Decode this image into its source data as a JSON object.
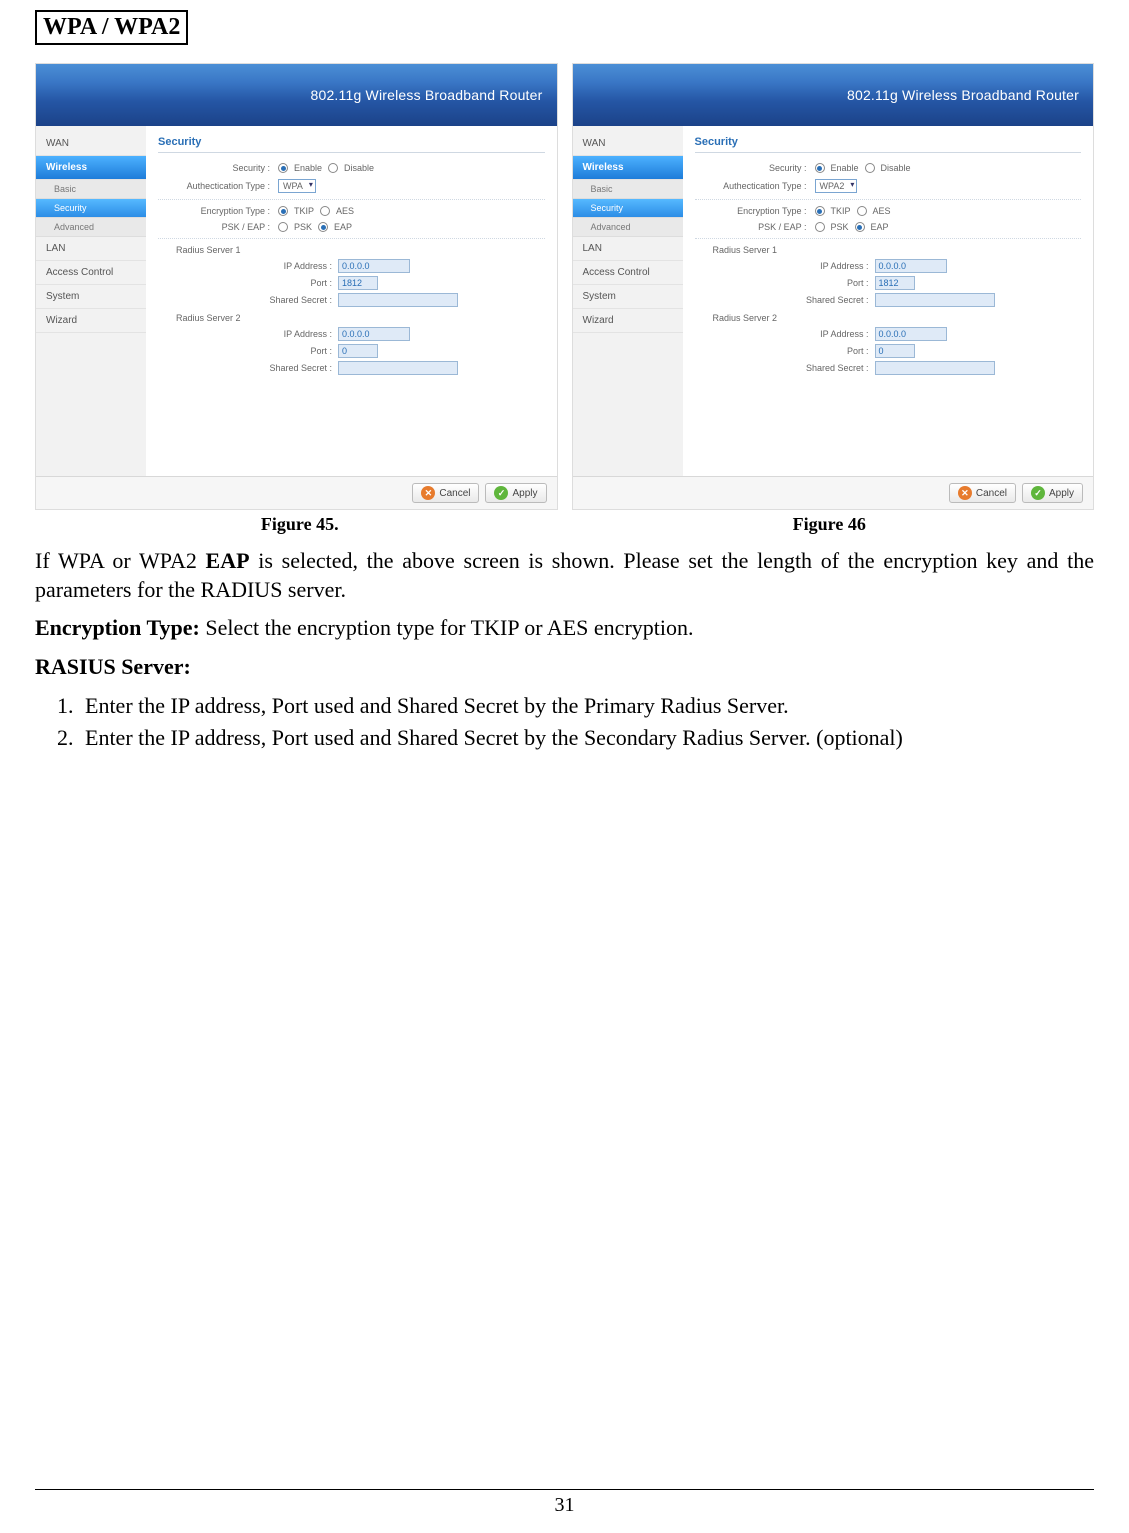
{
  "section_title": "WPA / WPA2",
  "captions": {
    "fig45": "Figure 45.",
    "fig46": "Figure 46"
  },
  "router": {
    "header": "802.11g Wireless Broadband Router",
    "sidebar": {
      "wan": "WAN",
      "wireless": "Wireless",
      "basic": "Basic",
      "security": "Security",
      "advanced": "Advanced",
      "lan": "LAN",
      "access": "Access Control",
      "system": "System",
      "wizard": "Wizard"
    },
    "panel_title": "Security",
    "labels": {
      "security": "Security :",
      "auth": "Authectication Type :",
      "enc": "Encryption Type :",
      "pskeap": "PSK / EAP :",
      "rs1": "Radius Server 1",
      "rs2": "Radius Server 2",
      "ip": "IP Address :",
      "port": "Port :",
      "secret": "Shared Secret :"
    },
    "options": {
      "enable": "Enable",
      "disable": "Disable",
      "tkip": "TKIP",
      "aes": "AES",
      "psk": "PSK",
      "eap": "EAP",
      "wpa": "WPA",
      "wpa2": "WPA2"
    },
    "values": {
      "ip": "0.0.0.0",
      "port1": "1812",
      "port2": "0"
    },
    "buttons": {
      "cancel": "Cancel",
      "apply": "Apply"
    }
  },
  "text": {
    "p1a": "If WPA or WPA2 ",
    "p1b": "EAP",
    "p1c": " is selected, the above screen is shown.  Please set the length of the encryption key and the parameters for the RADIUS server.",
    "p2a": "Encryption Type:",
    "p2b": " Select the encryption type for TKIP or AES encryption.",
    "p3": "RASIUS Server:",
    "li1": "Enter the IP address, Port used and Shared Secret by the Primary Radius Server.",
    "li2": "Enter the IP address, Port used and Shared Secret by the Secondary Radius Server. (optional)"
  },
  "page_number": "31"
}
